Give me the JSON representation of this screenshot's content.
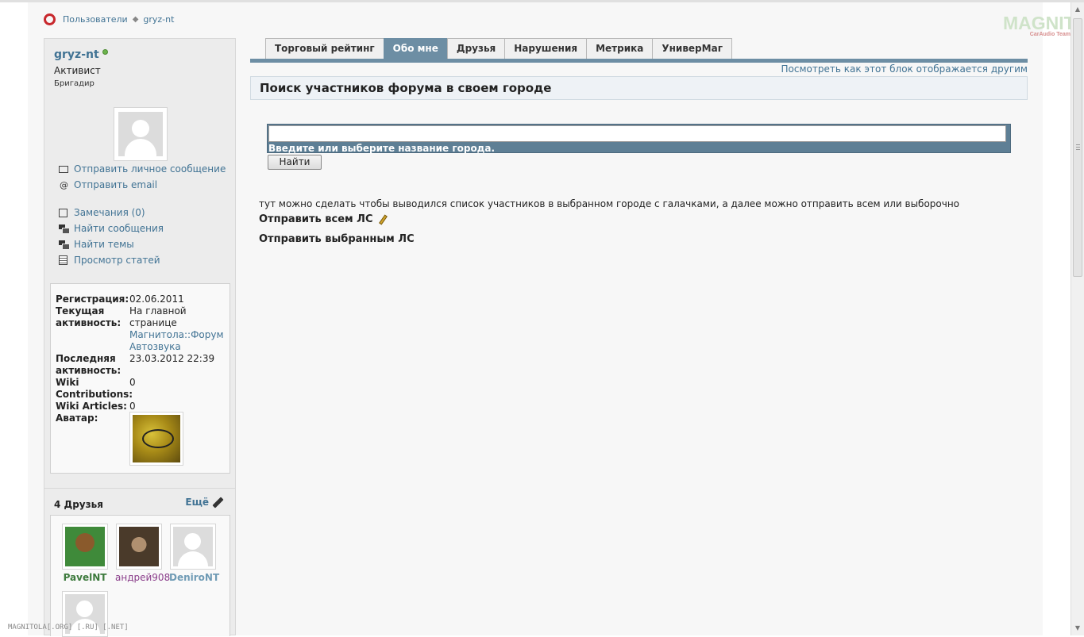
{
  "breadcrumb": {
    "root": "Пользователи",
    "current": "gryz-nt"
  },
  "logo": {
    "main": "MAGNITOLA",
    "sub": "CarAudio Team"
  },
  "profile": {
    "username": "gryz-nt",
    "usertitle": "Активист",
    "rank": "Бригадир",
    "links": [
      {
        "label": "Отправить личное сообщение",
        "icon": "mail-icon"
      },
      {
        "label": "Отправить email",
        "icon": "at-icon"
      },
      {
        "label": "Замечания (0)",
        "icon": "notice-icon"
      },
      {
        "label": "Найти сообщения",
        "icon": "posts-icon"
      },
      {
        "label": "Найти темы",
        "icon": "threads-icon"
      },
      {
        "label": "Просмотр статей",
        "icon": "articles-icon"
      }
    ]
  },
  "info": [
    {
      "label": "Регистрация:",
      "value": "02.06.2011"
    },
    {
      "label": "Текущая активность:",
      "value": "На главной странице",
      "link": "Магнитола::Форум Автозвука"
    },
    {
      "label": "Последняя активность:",
      "value": "23.03.2012 22:39"
    },
    {
      "label": "Wiki Contributions:",
      "value": "0"
    },
    {
      "label": "Wiki Articles:",
      "value": "0"
    },
    {
      "label": "Аватар:",
      "value": ""
    }
  ],
  "friends": {
    "title": "4 Друзья",
    "more": "Ещё",
    "list": [
      {
        "name": "PavelNT",
        "color": "#3d7a3d"
      },
      {
        "name": "андрей908",
        "color": "#8a3d8a"
      },
      {
        "name": "DeniroNT",
        "color": "#6f9bb5"
      },
      {
        "name": "",
        "color": "#222222"
      }
    ]
  },
  "tabs": [
    {
      "label": "Торговый рейтинг",
      "active": false
    },
    {
      "label": "Обо мне",
      "active": true
    },
    {
      "label": "Друзья",
      "active": false
    },
    {
      "label": "Нарушения",
      "active": false
    },
    {
      "label": "Метрика",
      "active": false
    },
    {
      "label": "УниверМаг",
      "active": false
    }
  ],
  "main": {
    "preview_link": "Посмотреть как этот блок отображается другим",
    "block_title": "Поиск участников форума в своем городе",
    "search_value": "",
    "search_hint": "Введите или выберите название города.",
    "search_button": "Найти",
    "description": "тут можно сделать чтобы выводился список участников в выбранном городе с галачками, а далее можно отправить всем или выборочно",
    "send_all": "Отправить всем ЛС",
    "send_selected": "Отправить выбранным ЛС"
  },
  "footer": "MAGNITOLA[.ORG] [.RU] [.NET]",
  "colors": {
    "accent": "#6d8ea4",
    "link": "#417394",
    "online": "#6cb34c"
  }
}
